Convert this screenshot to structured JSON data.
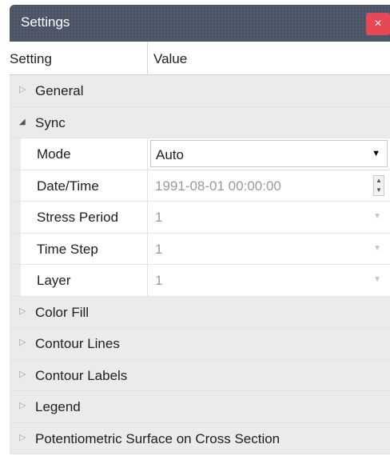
{
  "window": {
    "title": "Settings",
    "close_label": "×"
  },
  "header": {
    "setting": "Setting",
    "value": "Value"
  },
  "groups": {
    "general": {
      "label": "General",
      "expander": "▷"
    },
    "sync": {
      "label": "Sync",
      "expander": "◢"
    },
    "color_fill": {
      "label": "Color Fill",
      "expander": "▷"
    },
    "contour_lines": {
      "label": "Contour Lines",
      "expander": "▷"
    },
    "contour_labels": {
      "label": "Contour Labels",
      "expander": "▷"
    },
    "legend": {
      "label": "Legend",
      "expander": "▷"
    },
    "potentiometric": {
      "label": "Potentiometric Surface on Cross Section",
      "expander": "▷"
    }
  },
  "sync": {
    "mode": {
      "label": "Mode",
      "value": "Auto",
      "arrow": "▼"
    },
    "datetime": {
      "label": "Date/Time",
      "value": "1991-08-01 00:00:00",
      "up": "▲",
      "down": "▼"
    },
    "stress_period": {
      "label": "Stress Period",
      "value": "1",
      "arrow": "▼"
    },
    "time_step": {
      "label": "Time Step",
      "value": "1",
      "arrow": "▼"
    },
    "layer": {
      "label": "Layer",
      "value": "1",
      "arrow": "▼"
    }
  },
  "colors": {
    "titlebar": "#4b5567",
    "close": "#e74856",
    "group_bg": "#ebebeb",
    "disabled_text": "#9a9a9a"
  },
  "icons": {
    "close": "close-icon",
    "collapsed": "expand-triangle-icon",
    "expanded": "collapse-triangle-icon",
    "dropdown": "chevron-down-icon",
    "spinner": "spinner-arrows-icon"
  }
}
